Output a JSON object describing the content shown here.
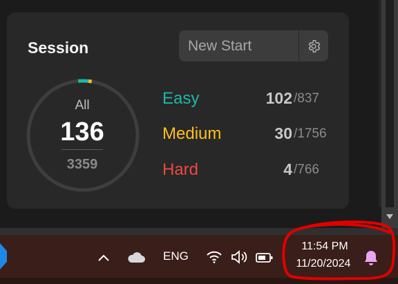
{
  "session_card": {
    "title": "Session",
    "session_input": {
      "value": "New Start"
    },
    "all": {
      "label": "All",
      "solved": "136",
      "total": "3359"
    },
    "difficulties": [
      {
        "name": "Easy",
        "solved": "102",
        "total": "/837",
        "color": "#1cb8a6"
      },
      {
        "name": "Medium",
        "solved": "30",
        "total": "/1756",
        "color": "#ffc01e"
      },
      {
        "name": "Hard",
        "solved": "4",
        "total": "/766",
        "color": "#ef4743"
      }
    ],
    "progress_ring": {
      "solved_fraction": 0.0405,
      "track_color": "#3e3e3e"
    }
  },
  "taskbar": {
    "tray_icons": [
      "chevron-up-icon",
      "onedrive-cloud-icon",
      "wifi-icon",
      "volume-icon",
      "battery-icon",
      "notification-bell-icon"
    ],
    "language": "ENG",
    "time": "11:54 PM",
    "date": "11/20/2024",
    "annotation_color": "#e00000"
  },
  "colors": {
    "card_bg": "#282828",
    "page_bg": "#1b1b1b",
    "taskbar_bg": "#3a1e19",
    "bell_color": "#e7a6f2"
  }
}
